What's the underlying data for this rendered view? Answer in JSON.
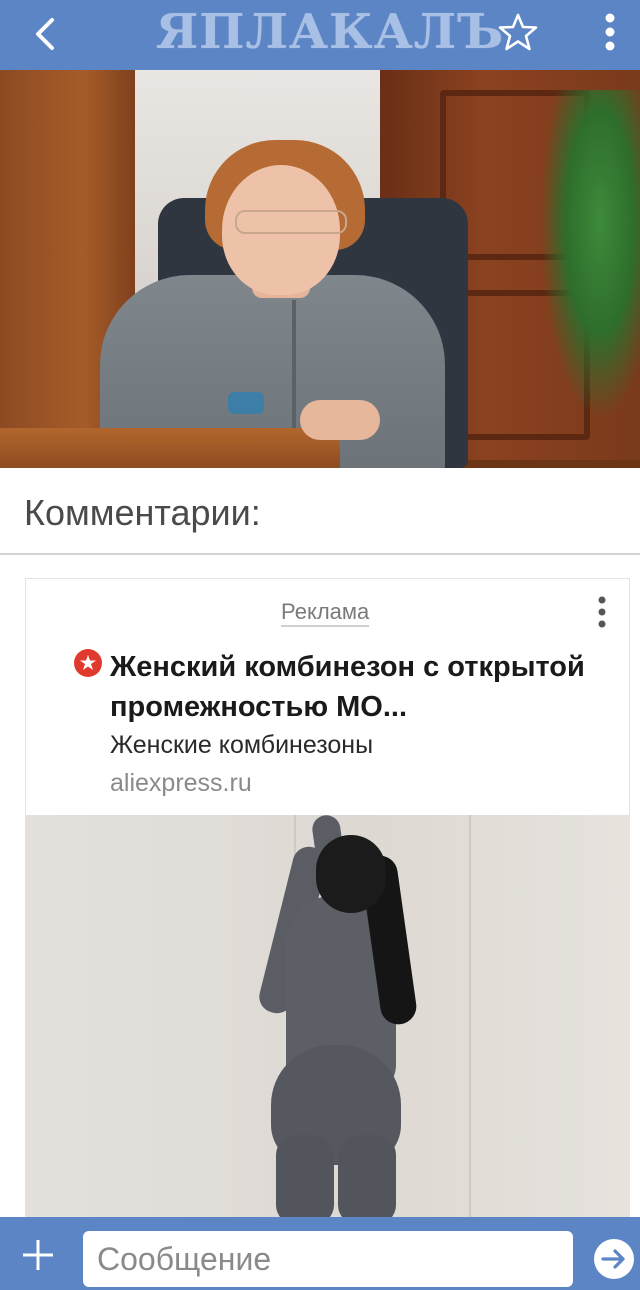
{
  "header": {
    "logo_text": "ЯПЛАКАЛЪ",
    "back_icon": "chevron-left-icon",
    "favorite_icon": "star-outline-icon",
    "more_icon": "more-vertical-icon",
    "bar_color": "#5b85c4"
  },
  "comments": {
    "title": "Комментарии:"
  },
  "ad": {
    "label": "Реклама",
    "more_icon": "more-vertical-icon",
    "badge_icon": "aliexpress-badge-icon",
    "title": "Женский комбинезон с открытой промежностью МО...",
    "subtitle": "Женские комбинезоны",
    "domain": "aliexpress.ru"
  },
  "composer": {
    "placeholder": "Сообщение",
    "add_icon": "plus-icon",
    "send_icon": "send-arrow-icon"
  }
}
